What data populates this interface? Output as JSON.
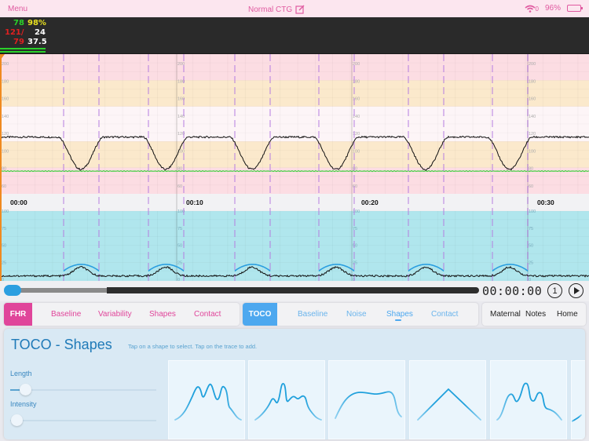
{
  "statusbar": {
    "menu_label": "Menu",
    "title": "Normal CTG",
    "edit_icon": "edit-icon",
    "wifi_icon": "wifi-icon",
    "wifi_count": "0",
    "battery_percent": "96%",
    "battery_level": 0.96
  },
  "vitals": {
    "fhr": "78",
    "spo2": "98%",
    "bp_systolic": "121/",
    "resp_rate": "24",
    "bp_diastolic": "79",
    "temperature": "37.5",
    "colors": {
      "green": "#2ad12a",
      "yellow": "#e8e020",
      "red": "#e02020",
      "white": "#ffffff"
    }
  },
  "chart": {
    "fhr_axis_labels": [
      "200",
      "180",
      "160",
      "140",
      "120",
      "100",
      "80",
      "60"
    ],
    "toco_axis_labels": [
      "100",
      "75",
      "50",
      "25",
      "0"
    ],
    "time_labels": [
      "00:00",
      "00:10",
      "00:20",
      "00:30"
    ],
    "fhr_baseline_bpm": 115,
    "fhr_deceleration_nadir_bpm": 78,
    "maternal_hr_bpm": 76,
    "toco_baseline": 5,
    "toco_peak": 18,
    "contraction_count": 6,
    "colors": {
      "pink_band": "#fcdde3",
      "amber_band": "#fbe9cc",
      "white_band": "#fdf5f7",
      "toco_bg": "#b0e6ed",
      "marker": "#b57de0",
      "maternal_line": "#3fcf3f",
      "toco_shape": "#2a9ee0"
    }
  },
  "playback": {
    "progress": 0.01,
    "time": "00:00:00",
    "speed_label": "1",
    "play_icon": "play-icon"
  },
  "fhr_tabs": {
    "lead": "FHR",
    "items": [
      "Baseline",
      "Variability",
      "Shapes",
      "Contact"
    ],
    "color": "#e0459a"
  },
  "toco_tabs": {
    "lead": "TOCO",
    "items": [
      "Baseline",
      "Noise",
      "Shapes",
      "Contact"
    ],
    "selected": "Shapes",
    "color": "#4da8ef"
  },
  "other_tabs": {
    "items": [
      "Maternal",
      "Notes",
      "Home"
    ]
  },
  "panel": {
    "title": "TOCO - Shapes",
    "hint": "Tap on a shape to select. Tap on the trace to add.",
    "length_label": "Length",
    "length_value": 0.1,
    "intensity_label": "Intensity",
    "intensity_value": 0.0,
    "shapes": [
      "multi-peak",
      "irregular-peak",
      "plateau",
      "triangle",
      "multi-peak-tail",
      "partial"
    ]
  }
}
